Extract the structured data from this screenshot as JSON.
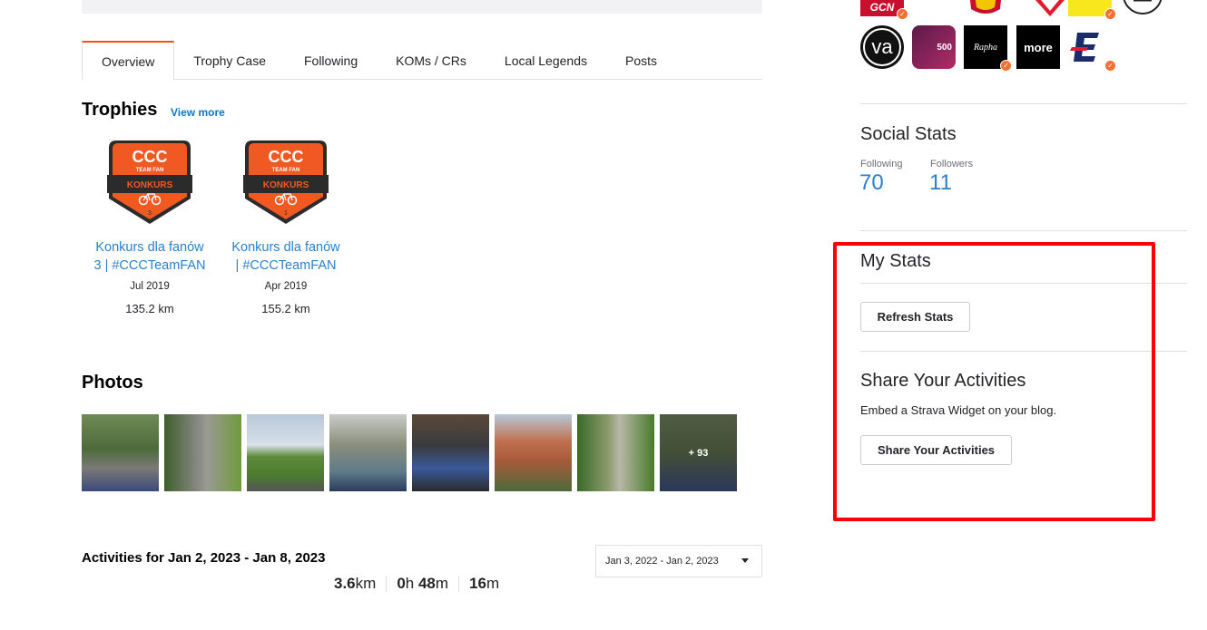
{
  "tabs": [
    {
      "label": "Overview",
      "active": true
    },
    {
      "label": "Trophy Case"
    },
    {
      "label": "Following"
    },
    {
      "label": "KOMs / CRs"
    },
    {
      "label": "Local Legends"
    },
    {
      "label": "Posts"
    }
  ],
  "trophies": {
    "title": "Trophies",
    "view_more": "View more",
    "items": [
      {
        "badge_top": "CCC",
        "badge_sub": "TEAM FAN",
        "badge_band": "KONKURS",
        "badge_num": "3",
        "name_line1": "Konkurs dla fanów",
        "name_line2": "3 | #CCCTeamFAN",
        "date": "Jul 2019",
        "distance": "135.2 km"
      },
      {
        "badge_top": "CCC",
        "badge_sub": "TEAM FAN",
        "badge_band": "KONKURS",
        "badge_num": "1",
        "name_line1": "Konkurs dla fanów",
        "name_line2": "| #CCCTeamFAN",
        "date": "Apr 2019",
        "distance": "155.2 km"
      }
    ]
  },
  "photos": {
    "title": "Photos",
    "more_label": "+ 93"
  },
  "activities": {
    "title": "Activities for Jan 2, 2023 - Jan 8, 2023",
    "date_range": "Jan 3, 2022 - Jan 2, 2023",
    "distance_num": "3.6",
    "distance_unit": "km",
    "time_h": "0",
    "time_h_unit": "h ",
    "time_m": "48",
    "time_m_unit": "m",
    "elev_num": "16",
    "elev_unit": "m"
  },
  "clubs": {
    "logos": [
      {
        "label": "GCN",
        "color": "#c8102e"
      },
      {
        "label": "va",
        "color": "#111111"
      },
      {
        "label": "500",
        "color": "#b02c66"
      },
      {
        "label": "Rapha",
        "color": "#000000"
      },
      {
        "label": "more",
        "color": "#000000"
      }
    ]
  },
  "social": {
    "title": "Social Stats",
    "following_label": "Following",
    "following_value": "70",
    "followers_label": "Followers",
    "followers_value": "11"
  },
  "my_stats": {
    "title": "My Stats",
    "refresh_label": "Refresh Stats"
  },
  "share": {
    "title": "Share Your Activities",
    "description": "Embed a Strava Widget on your blog.",
    "button_label": "Share Your Activities"
  },
  "colors": {
    "accent": "#fc5200",
    "link": "#2a80c9",
    "highlight": "#ff0000"
  }
}
